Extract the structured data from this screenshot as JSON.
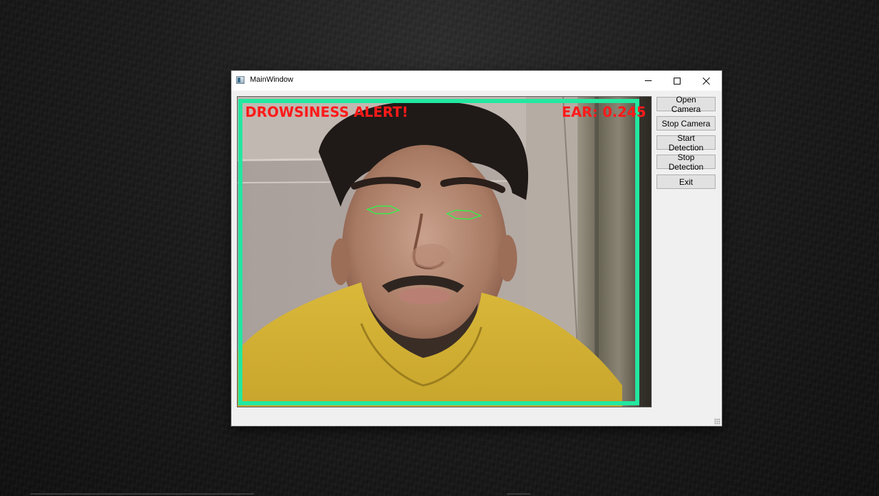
{
  "window": {
    "title": "MainWindow",
    "icon": "app-window-icon",
    "controls": [
      "minimize-icon",
      "maximize-icon",
      "close-icon"
    ]
  },
  "video": {
    "alert_text": "DROWSINESS ALERT!",
    "ear_text": "EAR: 0.245",
    "overlay_color": "#ff1a1a",
    "border_color": "#22e8a0",
    "eye_contour_color": "#22ff44"
  },
  "buttons": {
    "open_camera": "Open Camera",
    "stop_camera": "Stop Camera",
    "start_detection": "Start Detection",
    "stop_detection": "Stop Detection",
    "exit": "Exit"
  }
}
